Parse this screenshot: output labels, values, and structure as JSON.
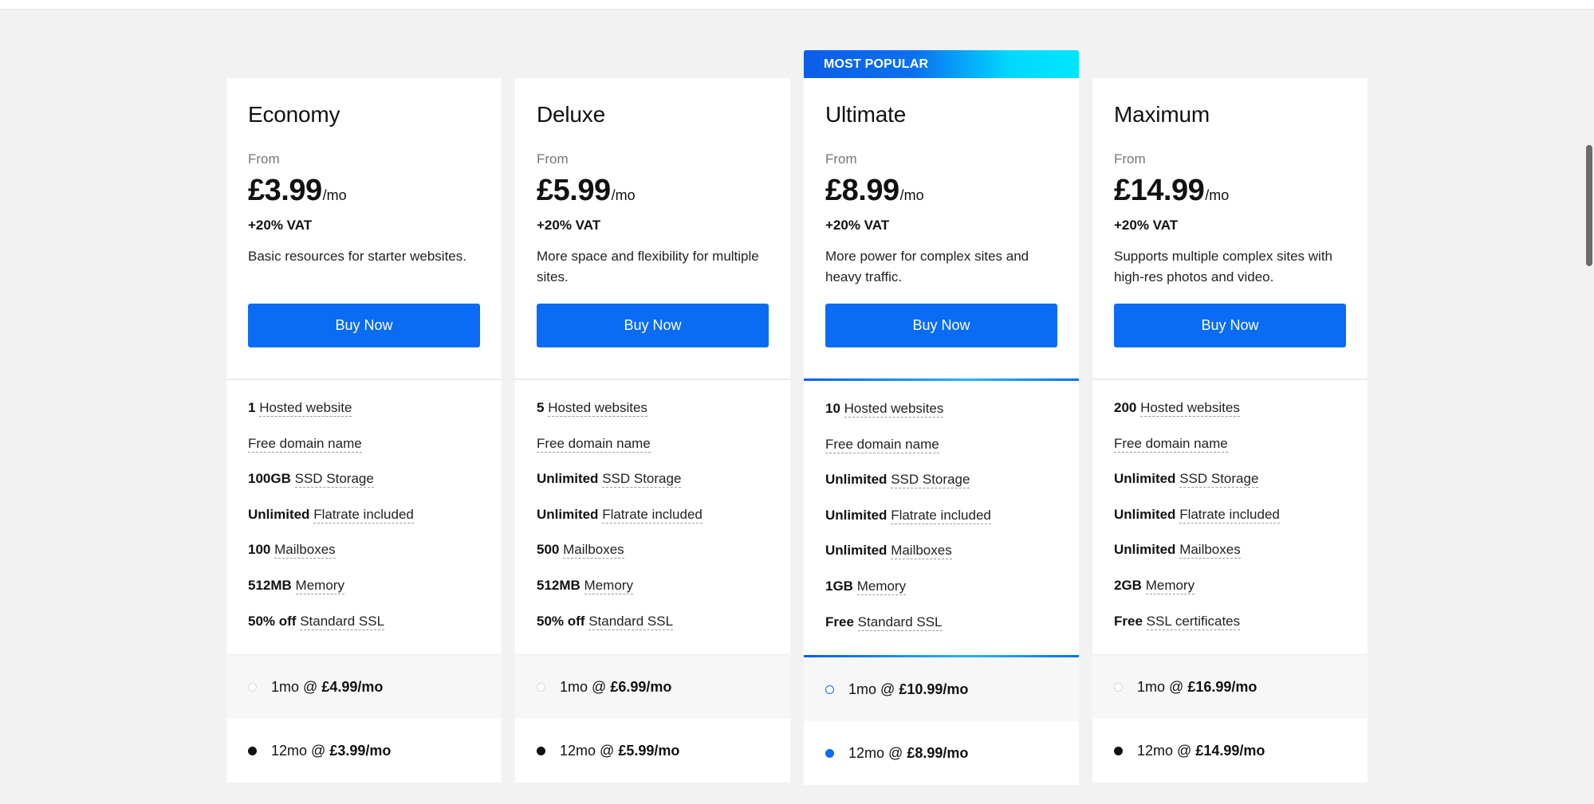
{
  "plans": [
    {
      "name": "Economy",
      "from_label": "From",
      "price": "£3.99",
      "per": "/mo",
      "vat": "+20% VAT",
      "description": "Basic resources for starter websites.",
      "buy_label": "Buy Now",
      "features": [
        {
          "value": "1",
          "label": "Hosted website"
        },
        {
          "value": "",
          "label": "Free domain name"
        },
        {
          "value": "100GB",
          "label": "SSD Storage"
        },
        {
          "value": "Unlimited",
          "label": "Flatrate included"
        },
        {
          "value": "100",
          "label": "Mailboxes"
        },
        {
          "value": "512MB",
          "label": "Memory"
        },
        {
          "value": "50% off",
          "label": "Standard SSL"
        }
      ],
      "terms": [
        {
          "term": "1mo @",
          "price": "£4.99/mo",
          "selected": false
        },
        {
          "term": "12mo @",
          "price": "£3.99/mo",
          "selected": true
        }
      ]
    },
    {
      "name": "Deluxe",
      "from_label": "From",
      "price": "£5.99",
      "per": "/mo",
      "vat": "+20% VAT",
      "description": "More space and flexibility for multiple sites.",
      "buy_label": "Buy Now",
      "features": [
        {
          "value": "5",
          "label": "Hosted websites"
        },
        {
          "value": "",
          "label": "Free domain name"
        },
        {
          "value": "Unlimited",
          "label": "SSD Storage"
        },
        {
          "value": "Unlimited",
          "label": "Flatrate included"
        },
        {
          "value": "500",
          "label": "Mailboxes"
        },
        {
          "value": "512MB",
          "label": "Memory"
        },
        {
          "value": "50% off",
          "label": "Standard SSL"
        }
      ],
      "terms": [
        {
          "term": "1mo @",
          "price": "£6.99/mo",
          "selected": false
        },
        {
          "term": "12mo @",
          "price": "£5.99/mo",
          "selected": true
        }
      ]
    },
    {
      "name": "Ultimate",
      "badge": "MOST POPULAR",
      "from_label": "From",
      "price": "£8.99",
      "per": "/mo",
      "vat": "+20% VAT",
      "description": "More power for complex sites and heavy traffic.",
      "buy_label": "Buy Now",
      "features": [
        {
          "value": "10",
          "label": "Hosted websites"
        },
        {
          "value": "",
          "label": "Free domain name"
        },
        {
          "value": "Unlimited",
          "label": "SSD Storage"
        },
        {
          "value": "Unlimited",
          "label": "Flatrate included"
        },
        {
          "value": "Unlimited",
          "label": "Mailboxes"
        },
        {
          "value": "1GB",
          "label": "Memory"
        },
        {
          "value": "Free",
          "label": "Standard SSL"
        }
      ],
      "terms": [
        {
          "term": "1mo @",
          "price": "£10.99/mo",
          "selected": false
        },
        {
          "term": "12mo @",
          "price": "£8.99/mo",
          "selected": true
        }
      ]
    },
    {
      "name": "Maximum",
      "from_label": "From",
      "price": "£14.99",
      "per": "/mo",
      "vat": "+20% VAT",
      "description": "Supports multiple complex sites with high-res photos and video.",
      "buy_label": "Buy Now",
      "features": [
        {
          "value": "200",
          "label": "Hosted websites"
        },
        {
          "value": "",
          "label": "Free domain name"
        },
        {
          "value": "Unlimited",
          "label": "SSD Storage"
        },
        {
          "value": "Unlimited",
          "label": "Flatrate included"
        },
        {
          "value": "Unlimited",
          "label": "Mailboxes"
        },
        {
          "value": "2GB",
          "label": "Memory"
        },
        {
          "value": "Free",
          "label": "SSL certificates"
        }
      ],
      "terms": [
        {
          "term": "1mo @",
          "price": "£16.99/mo",
          "selected": false
        },
        {
          "term": "12mo @",
          "price": "£14.99/mo",
          "selected": true
        }
      ]
    }
  ],
  "colors": {
    "accent": "#0a6cf5",
    "ribbon_start": "#0b5ee8",
    "ribbon_end": "#00e5ff",
    "page_bg": "#f2f2f2"
  }
}
